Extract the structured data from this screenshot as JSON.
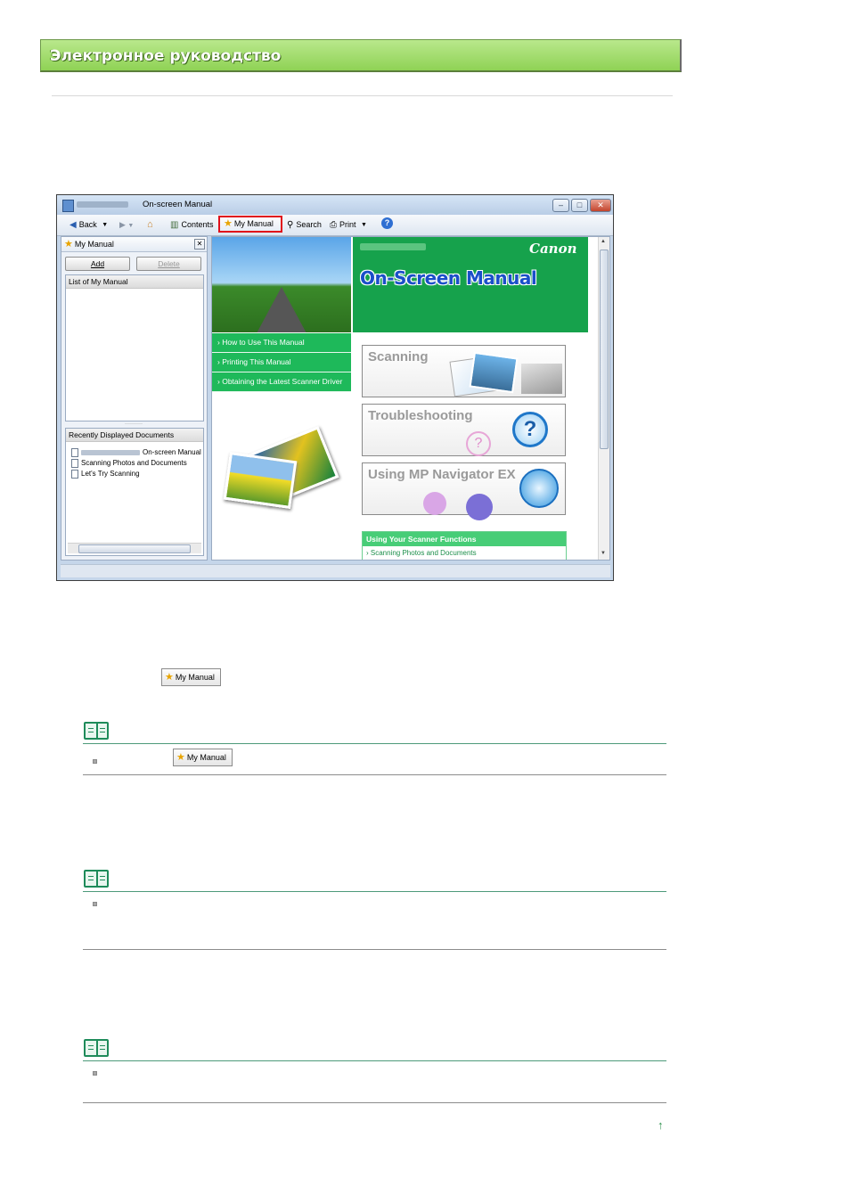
{
  "header": {
    "title": "Электронное руководство"
  },
  "screenshot": {
    "window_title": "On-screen Manual",
    "toolbar": {
      "back": "Back",
      "contents": "Contents",
      "my_manual": "My Manual",
      "search": "Search",
      "print": "Print"
    },
    "side_panel": {
      "title": "My Manual",
      "add": "Add",
      "delete": "Delete",
      "list_header": "List of My Manual",
      "recent_header": "Recently Displayed Documents",
      "recent_items": [
        "On-screen Manual",
        "Scanning Photos and Documents",
        "Let's Try Scanning"
      ]
    },
    "content": {
      "brand": "Canon",
      "heading": "On-Screen Manual",
      "nav_links": [
        "How to Use This Manual",
        "Printing This Manual",
        "Obtaining the Latest Scanner Driver"
      ],
      "cards": [
        "Scanning",
        "Troubleshooting",
        "Using MP Navigator EX"
      ],
      "functions_heading": "Using Your Scanner Functions",
      "functions_link": "Scanning Photos and Documents"
    }
  },
  "inline_buttons": {
    "my_manual_1": "My Manual",
    "my_manual_2": "My Manual"
  },
  "colors": {
    "banner_green": "#8fd255",
    "brand_green": "#16a24c",
    "highlight_red": "#e00f1a",
    "note_green": "#1e8b5a"
  },
  "icons": [
    "star-icon",
    "note-book-icon",
    "page-top-arrow-icon",
    "help-icon",
    "search-icon",
    "print-icon"
  ]
}
